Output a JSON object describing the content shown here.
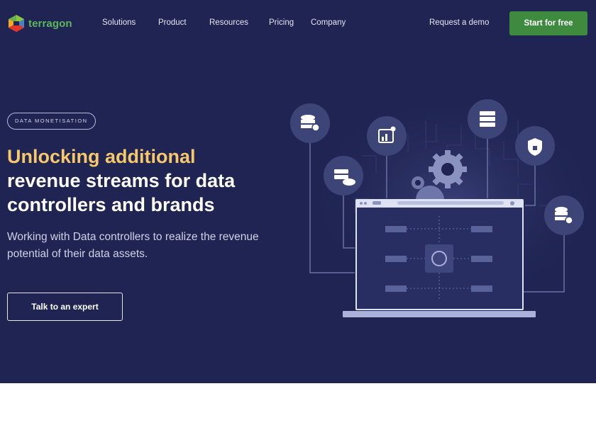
{
  "brand": {
    "name": "terragon",
    "colors": {
      "hero_bg": "#1f2452",
      "accent": "#f6c86b",
      "cta_green": "#3e8b40",
      "logo_green": "#5cb85c"
    }
  },
  "nav": {
    "links": [
      "Solutions",
      "Product",
      "Resources",
      "Pricing",
      "Company"
    ],
    "request_demo": "Request a demo",
    "start_label": "Start for free"
  },
  "hero": {
    "badge": "DATA MONETISATION",
    "headline_accent": "Unlocking additional",
    "headline_rest_1": "revenue streams for data",
    "headline_rest_2": "controllers and brands",
    "subtext": "Working with Data controllers to realize the revenue potential of their data assets.",
    "cta_label": "Talk to an expert"
  },
  "illustration": {
    "icons": [
      "database-user-icon",
      "server-cloud-icon",
      "analytics-icon",
      "server-rack-icon",
      "shield-lock-icon",
      "database-gear-icon",
      "gear-icon"
    ]
  }
}
